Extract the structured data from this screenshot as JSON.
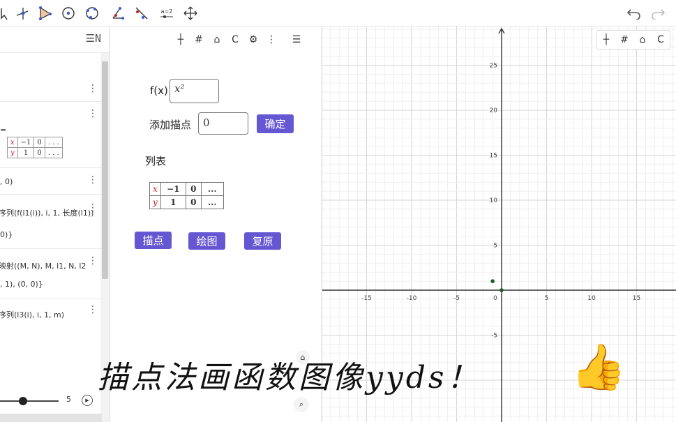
{
  "toolbar": {
    "tools": [
      "move-tool-icon",
      "point-tool-icon",
      "polygon-tool-icon",
      "circle-center-icon",
      "circle-three-points-icon",
      "angle-tool-icon",
      "reflect-tool-icon",
      "slider-tool-icon",
      "move-view-icon"
    ],
    "slider_tool_label": "a=2"
  },
  "algebra": {
    "rows": [
      {
        "text": "",
        "dots": "⋮"
      },
      {
        "text": "=",
        "dots": "⋮"
      },
      {
        "text": ", 0)",
        "dots": "⋮"
      },
      {
        "text": "序列(f(l1(i)), i, 1, 长度(l1))",
        "sub": "0)}",
        "dots": "⋮"
      },
      {
        "text": "映射((M, N), M, l1, N, l2",
        "sub": ", 1), (0, 0)}",
        "dots": "⋮"
      },
      {
        "text": "序列(l3(i), i, 1, m)",
        "dots": "⋮"
      }
    ],
    "mini_table": {
      "x_label": "x",
      "y_label": "y",
      "x_values": [
        "−1",
        "0",
        ". . ."
      ],
      "y_values": [
        "1",
        "0",
        ". . ."
      ]
    },
    "slider_value": "5",
    "sort_icon": "☰N"
  },
  "panel": {
    "function_label": "f(x)",
    "function_value": "x²",
    "add_point_label": "添加描点",
    "add_point_value": "0",
    "confirm_button": "确定",
    "list_label": "列表",
    "table": {
      "x_label": "x",
      "y_label": "y",
      "x_values": [
        "−1",
        "0",
        "..."
      ],
      "y_values": [
        "1",
        "0",
        "..."
      ]
    },
    "plot_points_button": "描点",
    "draw_graph_button": "绘图",
    "reset_button": "复原"
  },
  "graph": {
    "x_ticks": [
      -15,
      -10,
      -5,
      0,
      5,
      10,
      15
    ],
    "y_ticks": [
      -5,
      5,
      10,
      15,
      20,
      25
    ],
    "points": [
      {
        "x": -1,
        "y": 1
      },
      {
        "x": 0,
        "y": 0
      }
    ],
    "axis_color": "#333333",
    "grid_color": "#e0e0e0",
    "point_color": "#1f5a2b"
  },
  "overlay": {
    "caption": "描点法画函数图像yyds！",
    "emoji": "👍"
  },
  "colors": {
    "button": "#6557d2",
    "accent_red": "#cc2222"
  }
}
